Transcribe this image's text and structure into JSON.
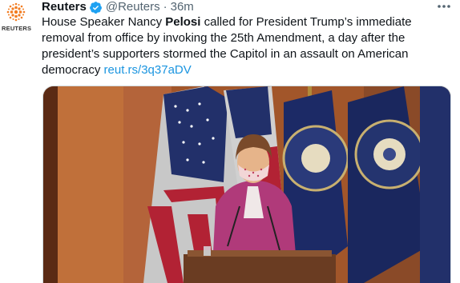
{
  "account": {
    "avatar_icon": "reuters-logo-icon",
    "avatar_text": "REUTERS",
    "name": "Reuters",
    "verified_icon": "verified-badge-icon",
    "handle": "@Reuters",
    "separator": "·",
    "time": "36m"
  },
  "more_icon": "more-options-icon",
  "tweet": {
    "text_before": "House Speaker Nancy ",
    "text_bold": "Pelosi",
    "text_after": " called for President Trump’s immediate removal from office by invoking the 25th Amendment, a day after the president’s supporters stormed the Capitol in an assault on American democracy ",
    "link": "reut.rs/3q37aDV"
  },
  "media": {
    "kind": "video-thumbnail",
    "icon": "video-frame-icon"
  },
  "colors": {
    "link": "#1b95e0",
    "verified": "#1da1f2",
    "logo_orange": "#f27c21"
  }
}
